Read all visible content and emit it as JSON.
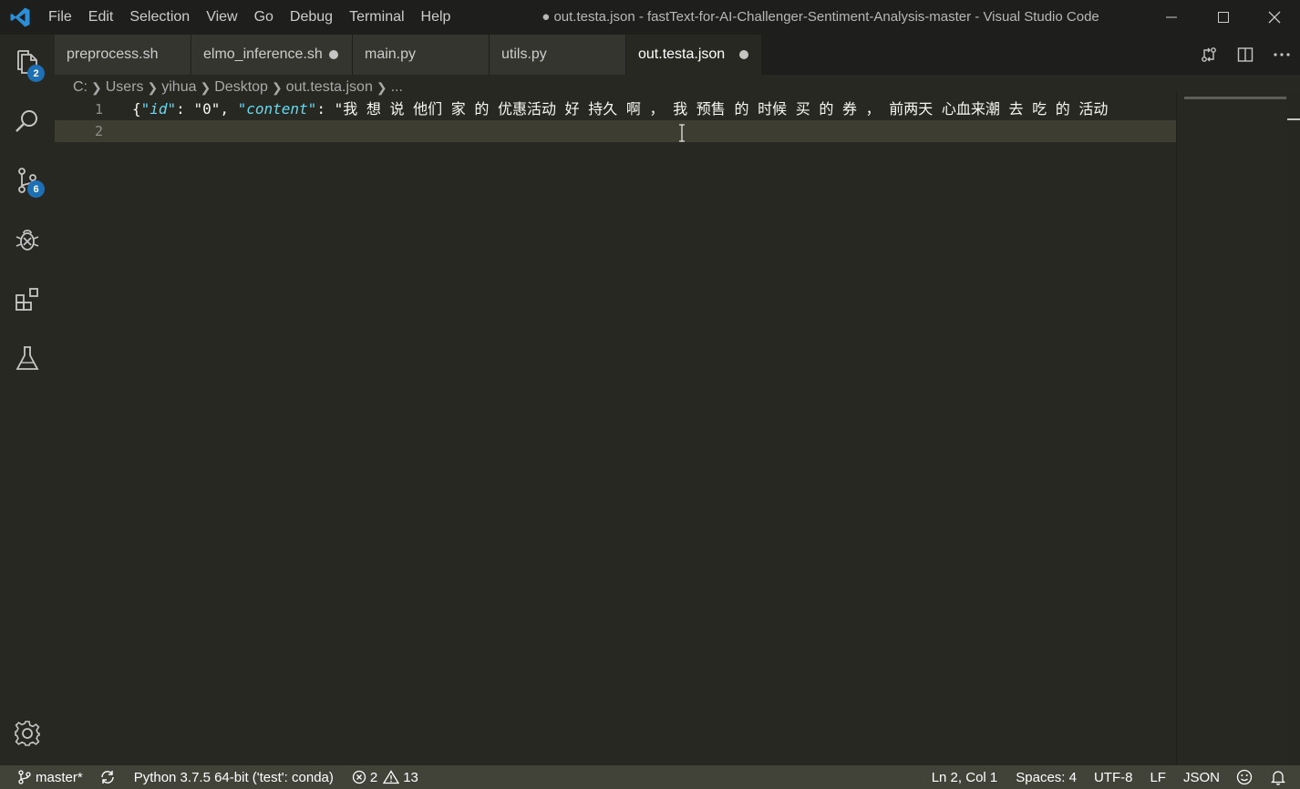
{
  "app": {
    "menu": [
      "File",
      "Edit",
      "Selection",
      "View",
      "Go",
      "Debug",
      "Terminal",
      "Help"
    ],
    "window_title": "● out.testa.json - fastText-for-AI-Challenger-Sentiment-Analysis-master - Visual Studio Code"
  },
  "activity_bar": {
    "explorer_badge": "2",
    "source_control_badge": "6"
  },
  "tabs": [
    {
      "label": "preprocess.sh",
      "dirty": false,
      "active": false
    },
    {
      "label": "elmo_inference.sh",
      "dirty": true,
      "active": false
    },
    {
      "label": "main.py",
      "dirty": false,
      "active": false
    },
    {
      "label": "utils.py",
      "dirty": false,
      "active": false
    },
    {
      "label": "out.testa.json",
      "dirty": true,
      "active": true
    }
  ],
  "breadcrumb": [
    "C:",
    "Users",
    "yihua",
    "Desktop",
    "out.testa.json",
    "..."
  ],
  "editor": {
    "line_numbers": [
      "1",
      "2"
    ],
    "line1": {
      "t1": "{",
      "t2": "\"id\"",
      "t3": ": \"0\", ",
      "t4": "\"content\"",
      "t5": ": \"我 想 说 他们 家 的 优惠活动 好 持久 啊 ， 我 预售 的 时候 买 的 券 ， 前两天 心血来潮 去 吃 的 活动"
    },
    "line2": ""
  },
  "status_bar": {
    "branch": "master*",
    "python": "Python 3.7.5 64-bit ('test': conda)",
    "errors": "2",
    "warnings": "13",
    "position": "Ln 2, Col 1",
    "spaces": "Spaces: 4",
    "encoding": "UTF-8",
    "eol": "LF",
    "language": "JSON"
  },
  "colors": {
    "editor_bg": "#272822",
    "status_bar_bg": "#414339",
    "badge_bg": "#1f6fb4",
    "json_key": "#66d9ef"
  }
}
